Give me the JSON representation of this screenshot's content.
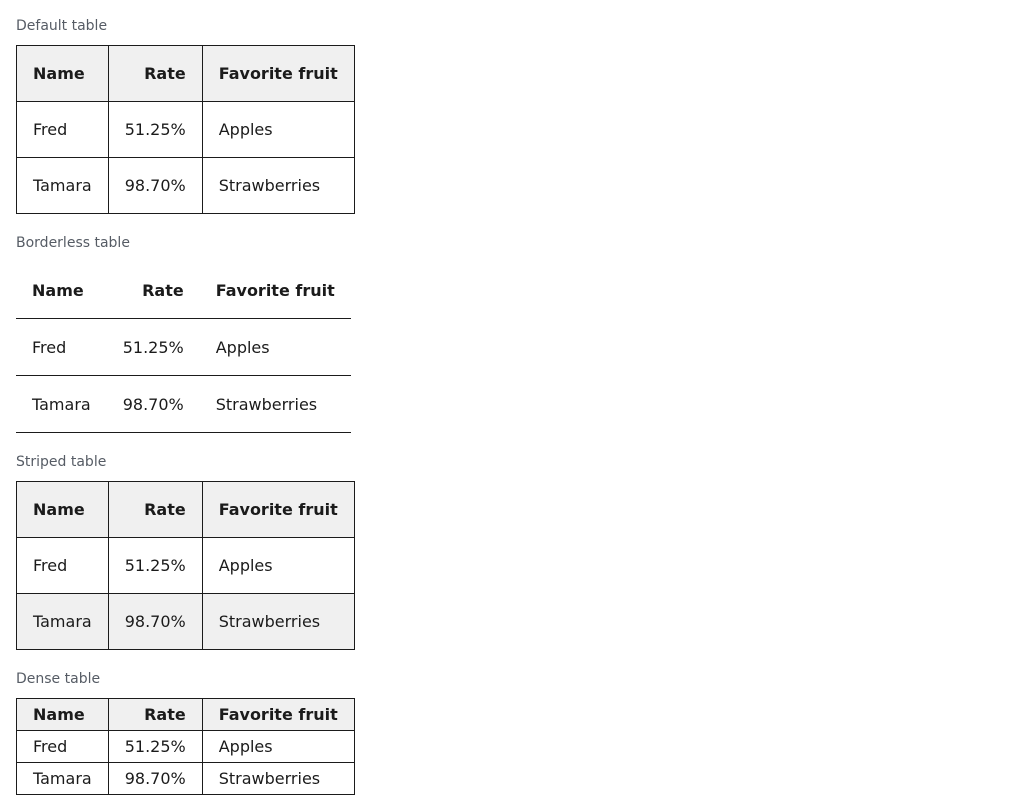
{
  "columns": {
    "name": "Name",
    "rate": "Rate",
    "fruit": "Favorite fruit"
  },
  "rows": [
    {
      "name": "Fred",
      "rate": "51.25%",
      "fruit": "Apples"
    },
    {
      "name": "Tamara",
      "rate": "98.70%",
      "fruit": "Strawberries"
    }
  ],
  "tables": {
    "default": {
      "caption": "Default table"
    },
    "borderless": {
      "caption": "Borderless table"
    },
    "striped": {
      "caption": "Striped table"
    },
    "dense": {
      "caption": "Dense table"
    }
  },
  "colors": {
    "text": "#1b1b1b",
    "caption": "#565c65",
    "header_bg": "#f0f0f0",
    "stripe_bg": "#f0f0f0",
    "border": "#1b1b1b"
  }
}
